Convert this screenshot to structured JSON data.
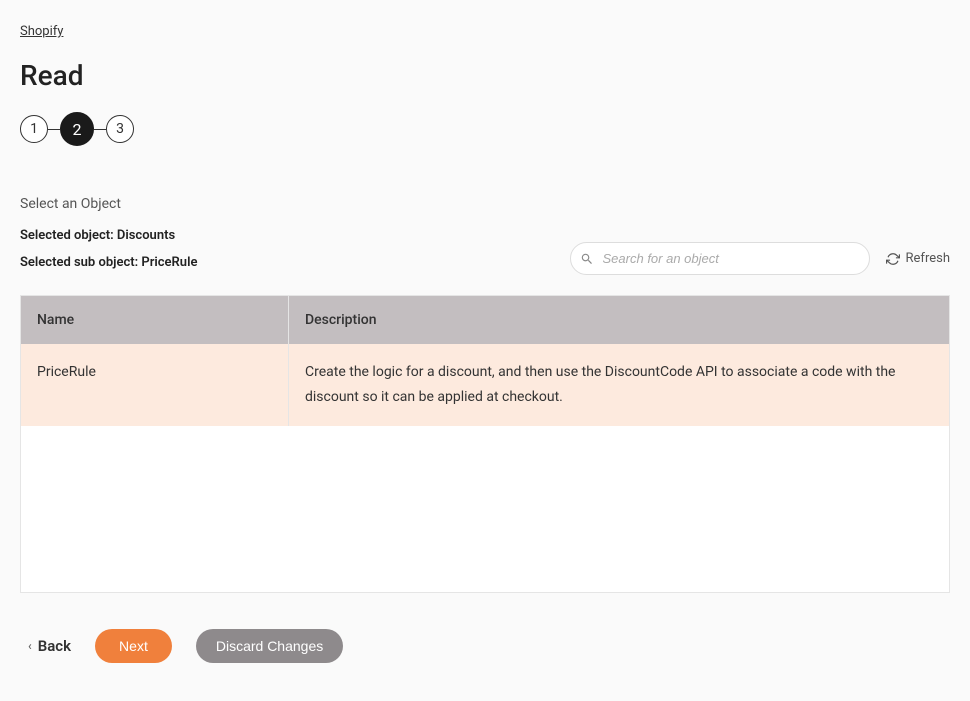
{
  "breadcrumb": {
    "label": "Shopify"
  },
  "page": {
    "title": "Read"
  },
  "stepper": {
    "steps": [
      "1",
      "2",
      "3"
    ],
    "activeIndex": 1
  },
  "section": {
    "subtitle": "Select an Object",
    "selectedObjectLabel": "Selected object: Discounts",
    "selectedSubObjectLabel": "Selected sub object: PriceRule"
  },
  "search": {
    "placeholder": "Search for an object"
  },
  "refresh": {
    "label": "Refresh"
  },
  "table": {
    "headers": {
      "name": "Name",
      "description": "Description"
    },
    "rows": [
      {
        "name": "PriceRule",
        "description": "Create the logic for a discount, and then use the DiscountCode API to associate a code with the discount so it can be applied at checkout."
      }
    ]
  },
  "footer": {
    "back": "Back",
    "next": "Next",
    "discard": "Discard Changes"
  }
}
